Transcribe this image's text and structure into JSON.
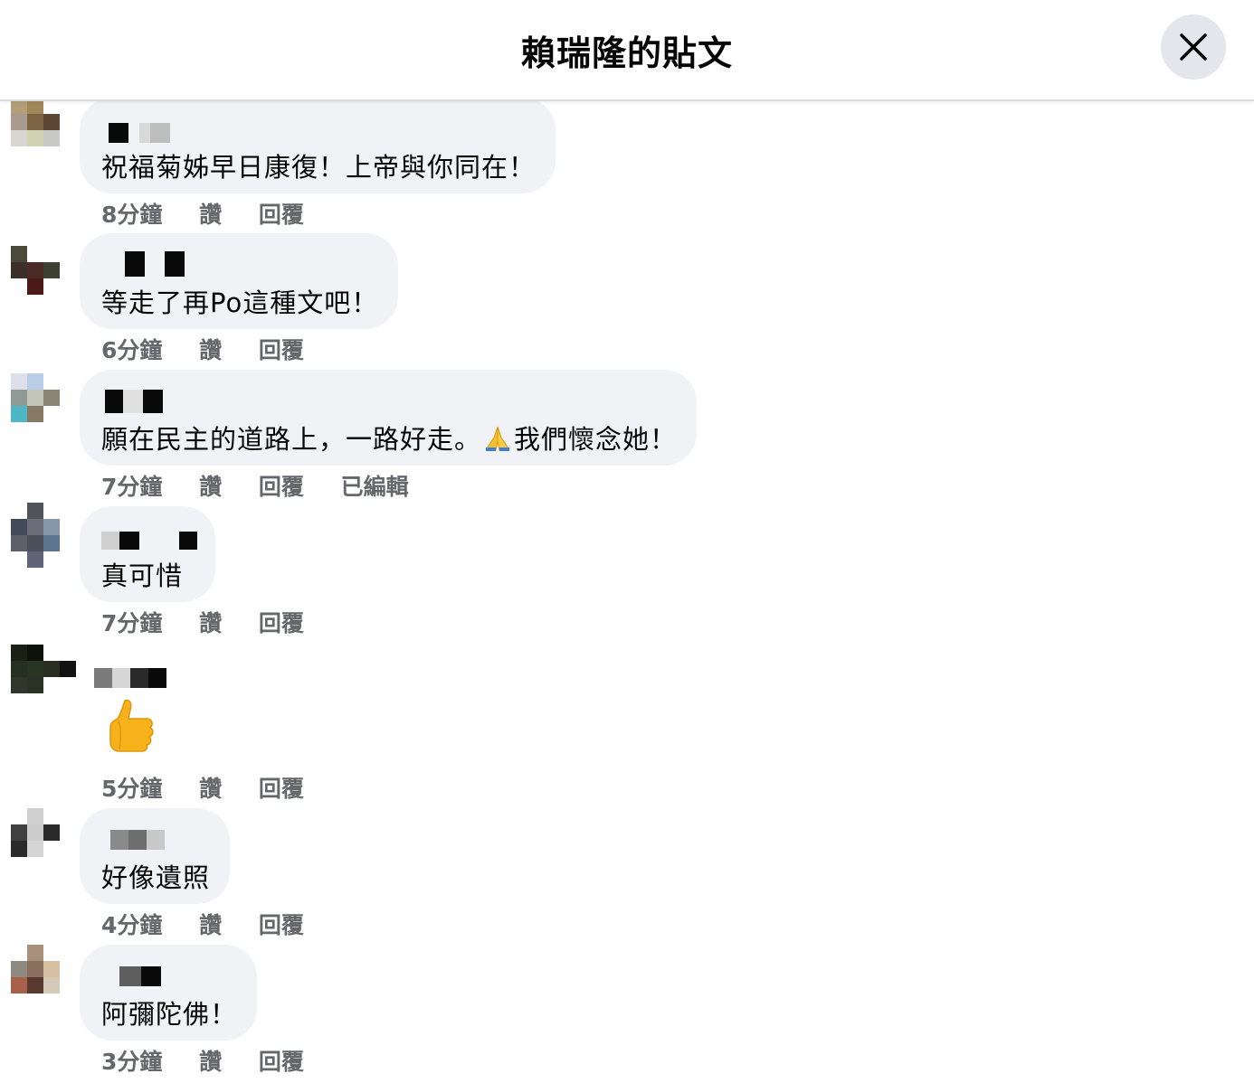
{
  "header": {
    "title": "賴瑞隆的貼文",
    "close_icon": "close-icon"
  },
  "comments": [
    {
      "text": "祝福菊姊早日康復！上帝與你同在！",
      "time": "8分鐘",
      "like": "讚",
      "reply": "回覆"
    },
    {
      "text": "等走了再Po這種文吧！",
      "time": "6分鐘",
      "like": "讚",
      "reply": "回覆"
    },
    {
      "text_before": "願在民主的道路上，一路好走。",
      "emoji": "folded-hands-emoji",
      "text_after": "我們懷念她！",
      "time": "7分鐘",
      "like": "讚",
      "reply": "回覆",
      "edited": "已編輯"
    },
    {
      "text": "真可惜",
      "time": "7分鐘",
      "like": "讚",
      "reply": "回覆"
    },
    {
      "emoji": "thumbs-up-emoji",
      "time": "5分鐘",
      "like": "讚",
      "reply": "回覆"
    },
    {
      "text": "好像遺照",
      "time": "4分鐘",
      "like": "讚",
      "reply": "回覆"
    },
    {
      "text": "阿彌陀佛！",
      "time": "3分鐘",
      "like": "讚",
      "reply": "回覆"
    }
  ],
  "colors": {
    "bubble": "#f0f2f5",
    "meta_text": "#65676b",
    "close_button_bg": "#e4e6eb",
    "header_border": "#dadde1"
  }
}
